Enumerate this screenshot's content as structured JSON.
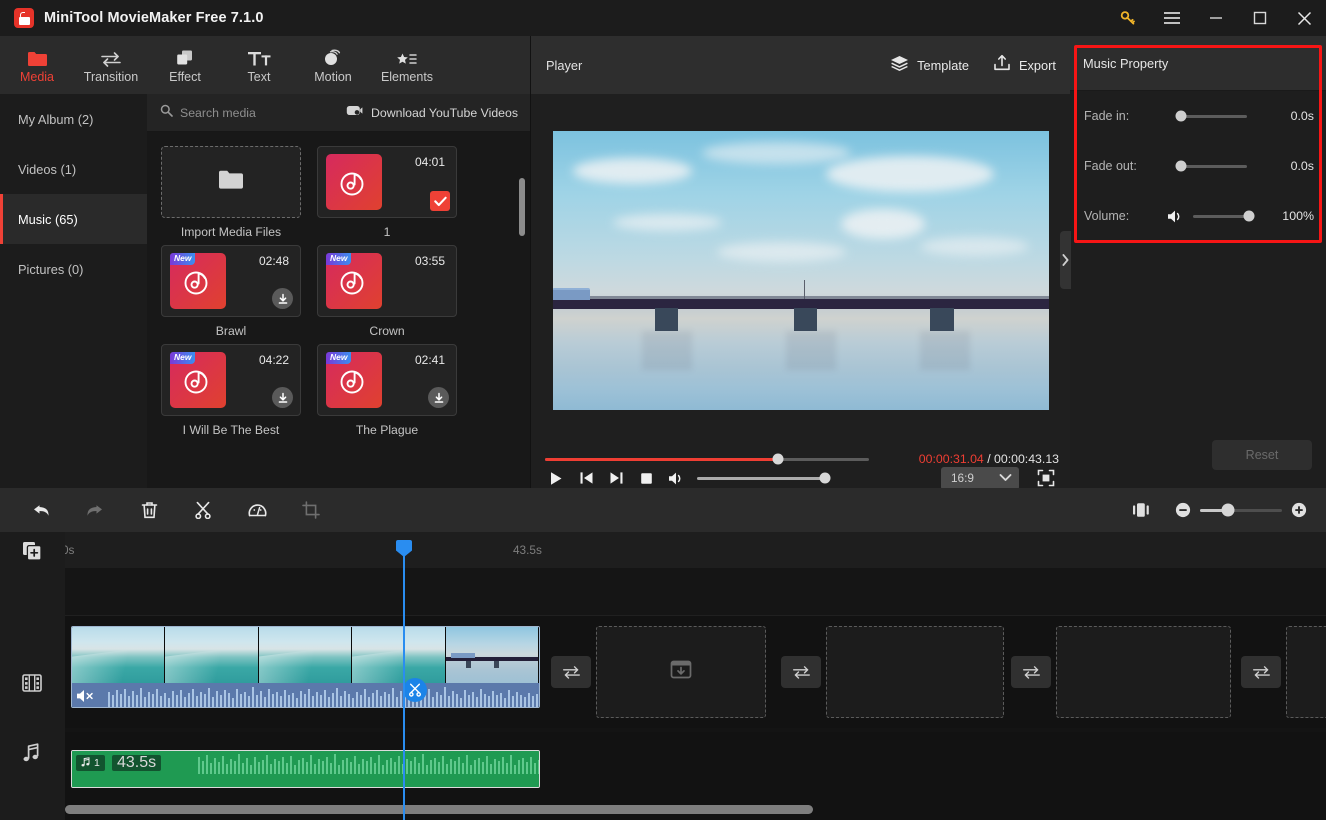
{
  "window": {
    "title": "MiniTool MovieMaker Free 7.1.0",
    "controls": {
      "key": "key-icon",
      "menu": "menu-icon",
      "minimize": "minimize-icon",
      "maximize": "maximize-icon",
      "close": "close-icon"
    }
  },
  "toolbar": {
    "items": [
      {
        "label": "Media",
        "icon": "folder-icon",
        "active": true
      },
      {
        "label": "Transition",
        "icon": "transition-arrows-icon",
        "active": false
      },
      {
        "label": "Effect",
        "icon": "layers-square-icon",
        "active": false
      },
      {
        "label": "Text",
        "icon": "text-tt-icon",
        "active": false
      },
      {
        "label": "Motion",
        "icon": "motion-sphere-icon",
        "active": false
      },
      {
        "label": "Elements",
        "icon": "star-list-icon",
        "active": false
      }
    ]
  },
  "sidebar": {
    "items": [
      {
        "label": "My Album (2)",
        "selected": false
      },
      {
        "label": "Videos (1)",
        "selected": false
      },
      {
        "label": "Music (65)",
        "selected": true
      },
      {
        "label": "Pictures (0)",
        "selected": false
      }
    ]
  },
  "media": {
    "search_placeholder": "Search media",
    "download_button": "Download YouTube Videos",
    "import_label": "Import Media Files",
    "items": [
      {
        "label": "1",
        "duration": "04:01",
        "new": false,
        "selected": true,
        "downloadable": false
      },
      {
        "label": "Brawl",
        "duration": "02:48",
        "new": true,
        "selected": false,
        "downloadable": true
      },
      {
        "label": "Crown",
        "duration": "03:55",
        "new": true,
        "selected": false,
        "downloadable": false
      },
      {
        "label": "I Will Be The Best",
        "duration": "04:22",
        "new": true,
        "selected": false,
        "downloadable": true
      },
      {
        "label": "The Plague",
        "duration": "02:41",
        "new": true,
        "selected": false,
        "downloadable": true
      }
    ],
    "new_badge_text": "New"
  },
  "player": {
    "title": "Player",
    "template_label": "Template",
    "export_label": "Export",
    "current_time": "00:00:31.04",
    "time_separator": "/",
    "total_time": "00:00:43.13",
    "progress_percent": "72",
    "aspect_ratio": "16:9",
    "volume_percent": "100"
  },
  "property": {
    "title": "Music Property",
    "rows": [
      {
        "label": "Fade in:",
        "value": "0.0s",
        "knob_percent": "0"
      },
      {
        "label": "Fade out:",
        "value": "0.0s",
        "knob_percent": "0"
      },
      {
        "label": "Volume:",
        "value": "100%",
        "knob_percent": "100"
      }
    ],
    "reset_label": "Reset",
    "highlight_color": "#f71515"
  },
  "timeline_toolbar": {
    "buttons": [
      {
        "name": "undo",
        "icon": "undo-arrow-icon"
      },
      {
        "name": "redo",
        "icon": "redo-arrow-icon"
      },
      {
        "name": "delete",
        "icon": "trash-icon"
      },
      {
        "name": "split",
        "icon": "scissors-icon"
      },
      {
        "name": "speed",
        "icon": "speedometer-icon"
      },
      {
        "name": "crop",
        "icon": "crop-icon"
      }
    ],
    "fit_icon": "fit-timeline-icon",
    "zoom_out_icon": "zoom-out-icon",
    "zoom_in_icon": "zoom-in-icon",
    "zoom_percent": "34"
  },
  "timeline": {
    "ruler_start": "0s",
    "ruler_end": "43.5s",
    "add_track_icon": "add-track-icon",
    "video_track_icon": "film-strip-icon",
    "audio_track_icon": "music-note-icon",
    "video_clip": {
      "muted": true
    },
    "audio_clip": {
      "index": "1",
      "duration": "43.5s"
    },
    "playhead_position_px": "403"
  }
}
